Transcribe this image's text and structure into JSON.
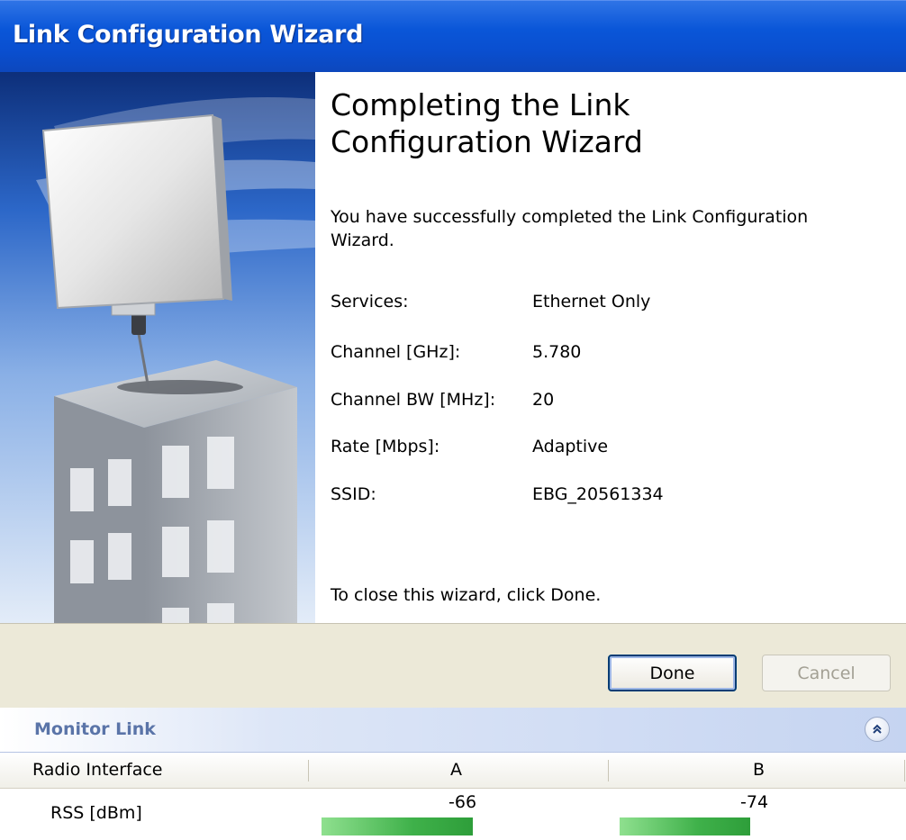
{
  "window": {
    "title": "Link Configuration Wizard"
  },
  "wizard": {
    "heading_line1": "Completing the Link",
    "heading_line2": "Configuration Wizard",
    "intro": "You have successfully completed the Link Configuration Wizard.",
    "summary": [
      {
        "label": "Services:",
        "value": "Ethernet Only"
      },
      {
        "label": "Channel [GHz]:",
        "value": "5.780"
      },
      {
        "label": "Channel BW [MHz]:",
        "value": "20"
      },
      {
        "label": "Rate [Mbps]:",
        "value": "Adaptive"
      },
      {
        "label": "SSID:",
        "value": "EBG_20561334"
      }
    ],
    "closing": "To close this wizard, click Done."
  },
  "buttons": {
    "done": "Done",
    "cancel": "Cancel"
  },
  "monitor": {
    "title": "Monitor Link",
    "collapse_icon": "double-chevron-up-icon",
    "columns": [
      "Radio Interface",
      "A",
      "B"
    ],
    "rss_label": "RSS [dBm]",
    "rss_a": "-66",
    "rss_b": "-74",
    "rss_a_level": 0.67,
    "rss_b_level": 0.58
  },
  "colors": {
    "titlebar": "#0a56d8",
    "buttonbar": "#ece9d8",
    "rss_bar": "#2e9e3a"
  }
}
